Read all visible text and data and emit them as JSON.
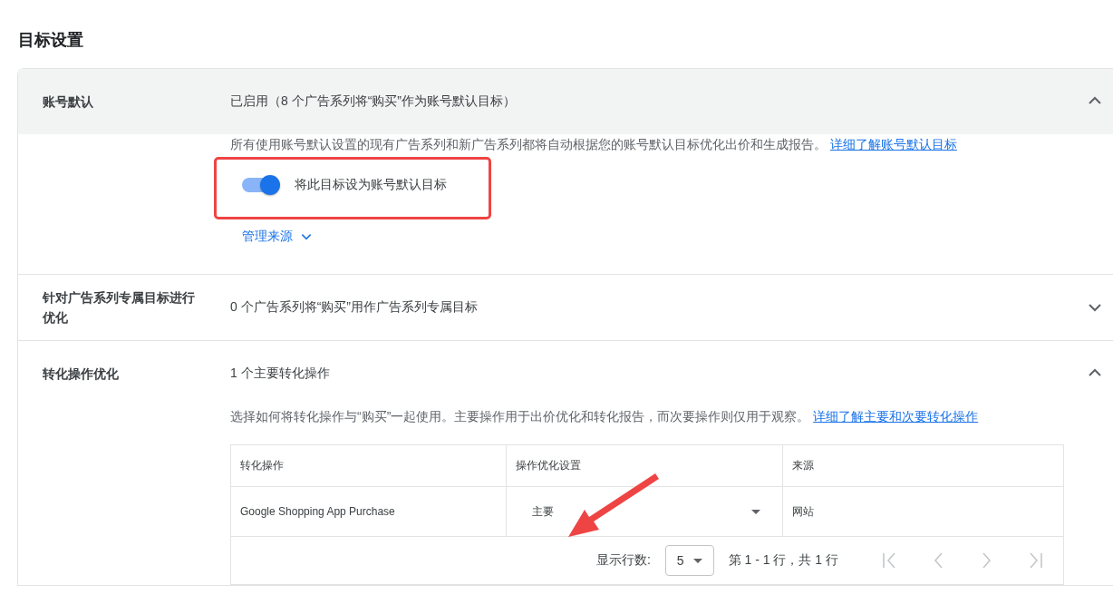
{
  "page_title": "目标设置",
  "sections": [
    {
      "kind": "toggle",
      "label": "账号默认",
      "summary": "已启用（8 个广告系列将“购买”作为账号默认目标）",
      "expanded": true,
      "highlighted": true,
      "description": "所有使用账号默认设置的现有广告系列和新广告系列都将自动根据您的账号默认目标优化出价和生成报告。",
      "link": "详细了解账号默认目标",
      "toggle": {
        "label": "将此目标设为账号默认目标",
        "on": true
      },
      "manage_link": "管理来源"
    },
    {
      "kind": "plain",
      "label": "针对广告系列专属目标进行优化",
      "summary": "0 个广告系列将“购买”用作广告系列专属目标",
      "expanded": false,
      "highlighted": false
    },
    {
      "kind": "table",
      "label": "转化操作优化",
      "summary": "1 个主要转化操作",
      "expanded": true,
      "highlighted": false,
      "description": "选择如何将转化操作与“购买”一起使用。主要操作用于出价优化和转化报告，而次要操作则仅用于观察。",
      "link": "详细了解主要和次要转化操作",
      "table": {
        "columns": [
          "转化操作",
          "操作优化设置",
          "来源"
        ],
        "rows": [
          {
            "action": "Google Shopping App Purchase",
            "setting": "主要",
            "source": "网站"
          }
        ],
        "pagination": {
          "rows_label": "显示行数:",
          "rows_value": "5",
          "range": "第 1 - 1 行，共 1 行",
          "first_disabled": true,
          "prev_disabled": true,
          "next_disabled": true,
          "last_disabled": true
        }
      }
    }
  ]
}
